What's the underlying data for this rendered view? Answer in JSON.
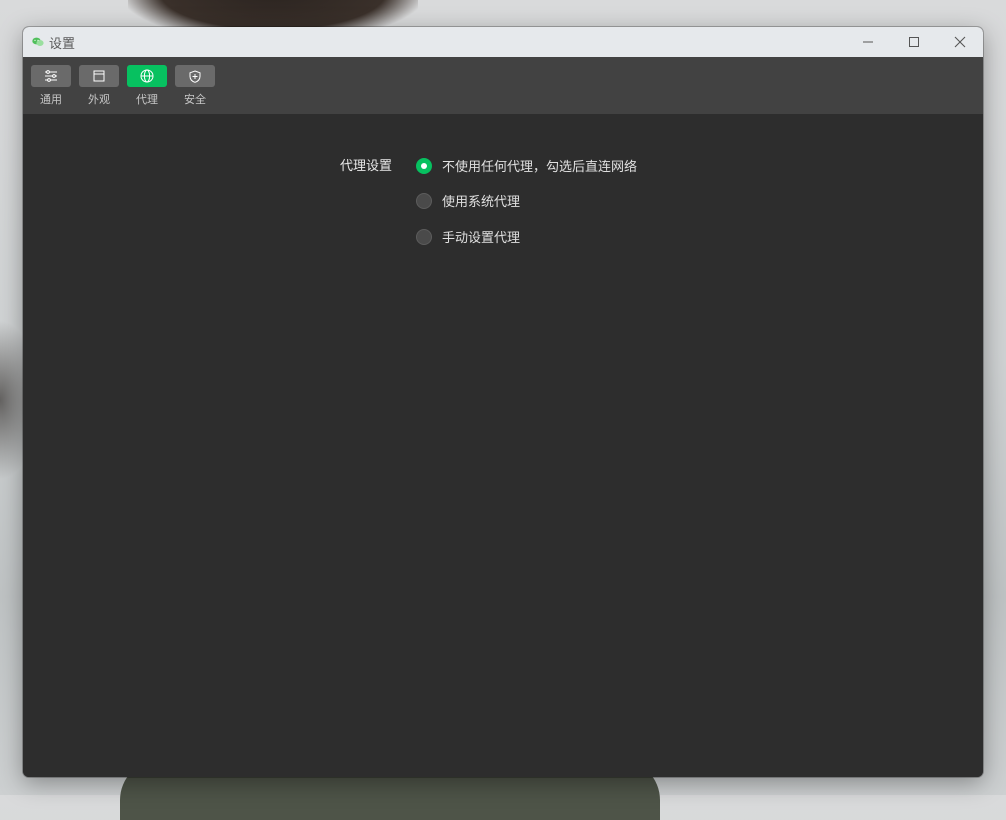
{
  "window": {
    "title": "设置"
  },
  "toolbar": {
    "items": [
      {
        "label": "通用",
        "icon": "sliders-icon",
        "active": false
      },
      {
        "label": "外观",
        "icon": "window-icon",
        "active": false
      },
      {
        "label": "代理",
        "icon": "globe-icon",
        "active": true
      },
      {
        "label": "安全",
        "icon": "shield-icon",
        "active": false
      }
    ]
  },
  "proxy": {
    "label": "代理设置",
    "options": [
      {
        "label": "不使用任何代理，勾选后直连网络",
        "checked": true
      },
      {
        "label": "使用系统代理",
        "checked": false
      },
      {
        "label": "手动设置代理",
        "checked": false
      }
    ]
  },
  "colors": {
    "accent": "#07c160",
    "window_bg": "#2d2d2d",
    "toolbar_bg": "#424242",
    "titlebar_bg": "#e6e9ec"
  }
}
